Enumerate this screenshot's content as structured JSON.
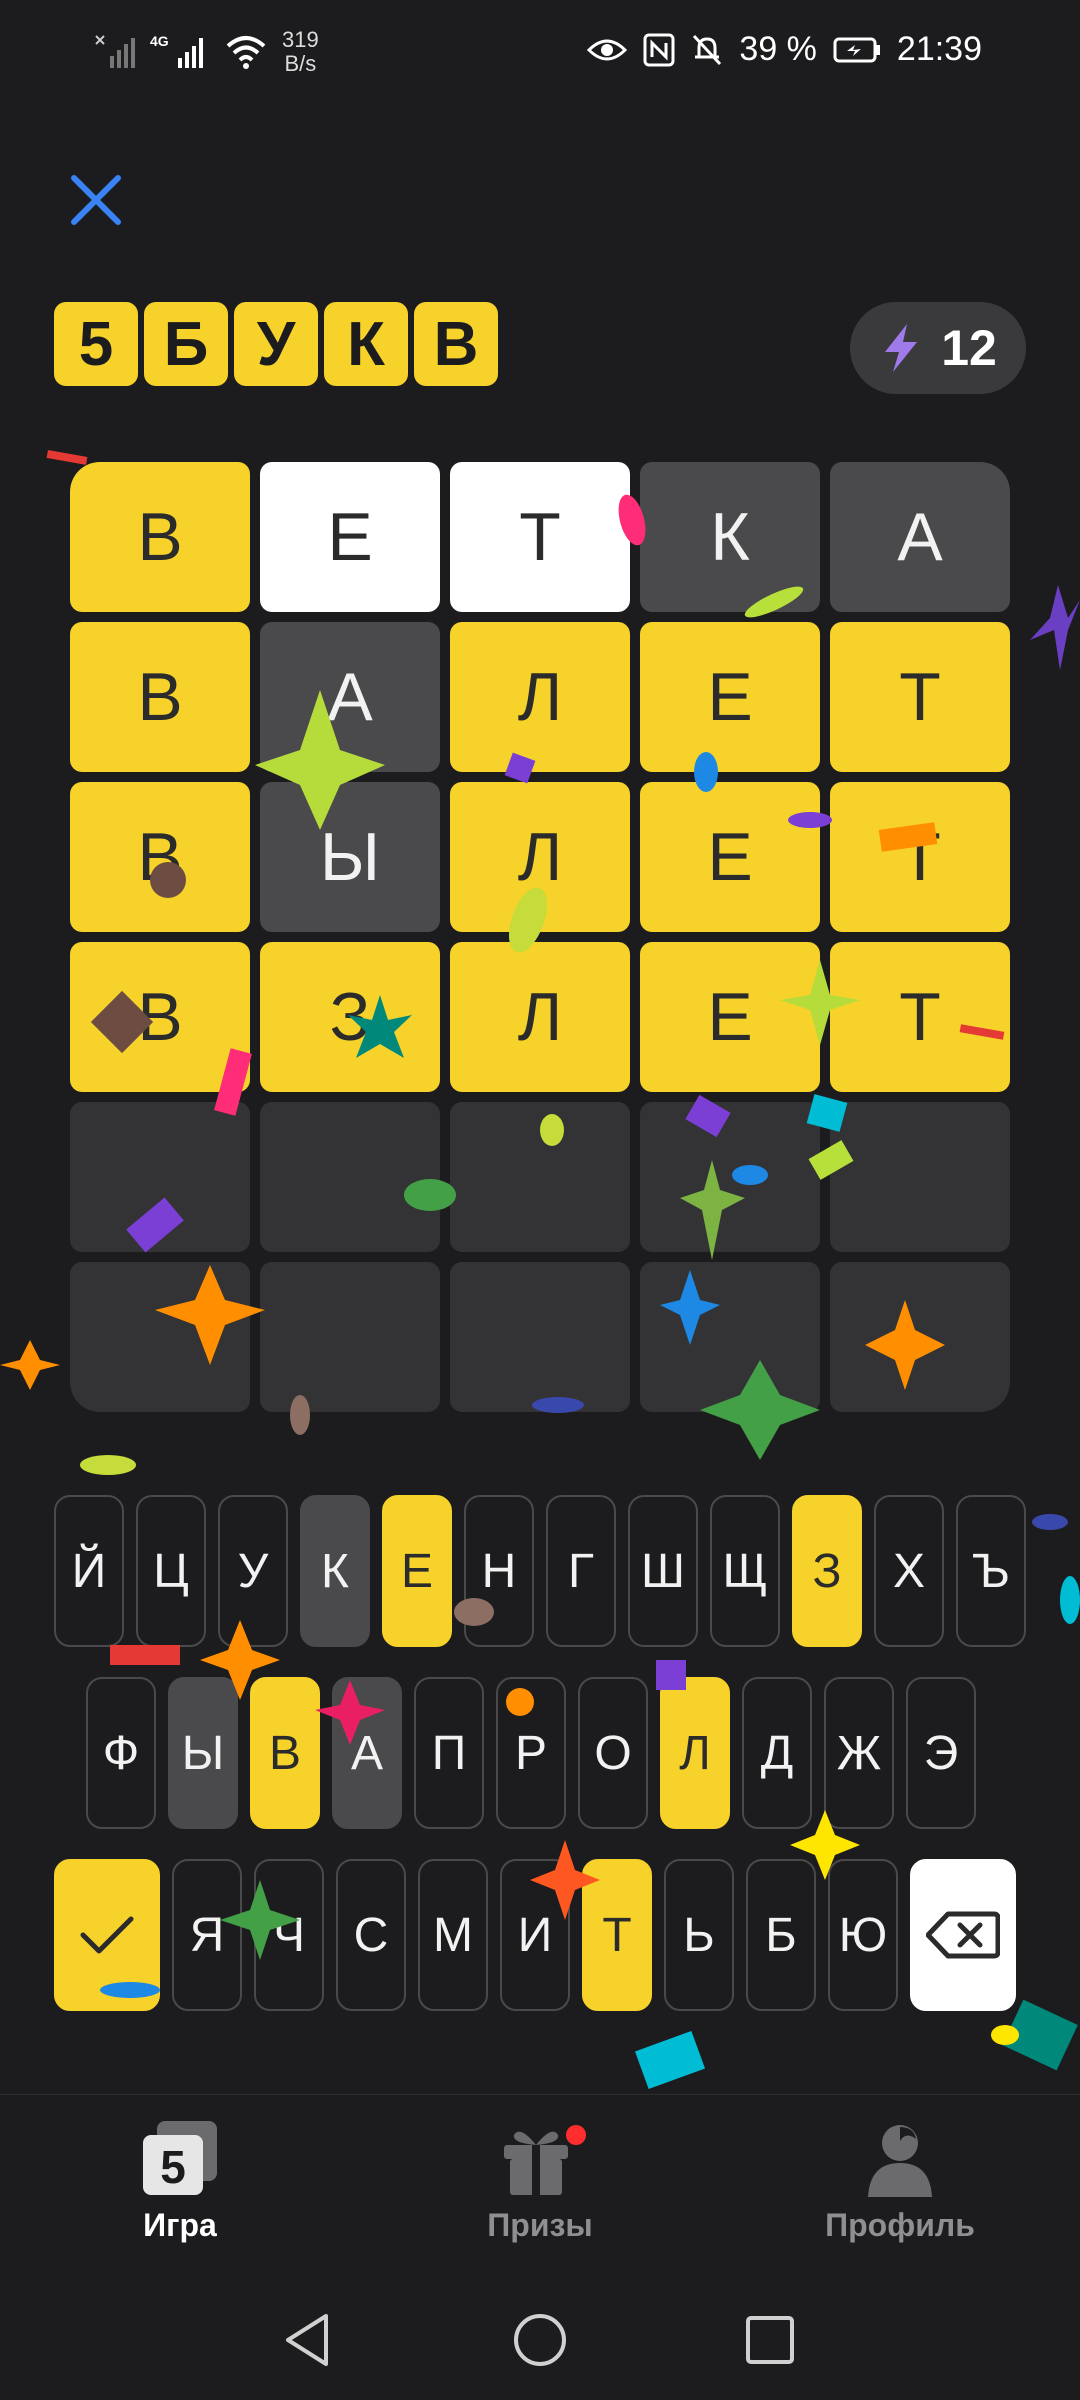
{
  "status_bar": {
    "net_speed_value": "319",
    "net_speed_unit": "B/s",
    "battery": "39 %",
    "time": "21:39"
  },
  "title_letters": [
    "5",
    "Б",
    "У",
    "К",
    "В"
  ],
  "energy": {
    "value": "12"
  },
  "board": [
    [
      {
        "l": "В",
        "s": "yellow"
      },
      {
        "l": "Е",
        "s": "white"
      },
      {
        "l": "Т",
        "s": "white"
      },
      {
        "l": "К",
        "s": "gray"
      },
      {
        "l": "А",
        "s": "gray"
      }
    ],
    [
      {
        "l": "В",
        "s": "yellow"
      },
      {
        "l": "А",
        "s": "gray"
      },
      {
        "l": "Л",
        "s": "yellow"
      },
      {
        "l": "Е",
        "s": "yellow"
      },
      {
        "l": "Т",
        "s": "yellow"
      }
    ],
    [
      {
        "l": "В",
        "s": "yellow"
      },
      {
        "l": "Ы",
        "s": "gray"
      },
      {
        "l": "Л",
        "s": "yellow"
      },
      {
        "l": "Е",
        "s": "yellow"
      },
      {
        "l": "Т",
        "s": "yellow"
      }
    ],
    [
      {
        "l": "В",
        "s": "yellow"
      },
      {
        "l": "З",
        "s": "yellow"
      },
      {
        "l": "Л",
        "s": "yellow"
      },
      {
        "l": "Е",
        "s": "yellow"
      },
      {
        "l": "Т",
        "s": "yellow"
      }
    ],
    [
      {
        "l": "",
        "s": "empty"
      },
      {
        "l": "",
        "s": "empty"
      },
      {
        "l": "",
        "s": "empty"
      },
      {
        "l": "",
        "s": "empty"
      },
      {
        "l": "",
        "s": "empty"
      }
    ],
    [
      {
        "l": "",
        "s": "empty"
      },
      {
        "l": "",
        "s": "empty"
      },
      {
        "l": "",
        "s": "empty"
      },
      {
        "l": "",
        "s": "empty"
      },
      {
        "l": "",
        "s": "empty"
      }
    ]
  ],
  "keyboard": {
    "row1": [
      {
        "k": "Й",
        "s": ""
      },
      {
        "k": "Ц",
        "s": ""
      },
      {
        "k": "У",
        "s": ""
      },
      {
        "k": "К",
        "s": "gray"
      },
      {
        "k": "Е",
        "s": "yellow"
      },
      {
        "k": "Н",
        "s": ""
      },
      {
        "k": "Г",
        "s": ""
      },
      {
        "k": "Ш",
        "s": ""
      },
      {
        "k": "Щ",
        "s": ""
      },
      {
        "k": "З",
        "s": "yellow"
      },
      {
        "k": "Х",
        "s": ""
      },
      {
        "k": "Ъ",
        "s": ""
      }
    ],
    "row2": [
      {
        "k": "Ф",
        "s": ""
      },
      {
        "k": "Ы",
        "s": "gray"
      },
      {
        "k": "В",
        "s": "yellow"
      },
      {
        "k": "А",
        "s": "gray"
      },
      {
        "k": "П",
        "s": ""
      },
      {
        "k": "Р",
        "s": ""
      },
      {
        "k": "О",
        "s": ""
      },
      {
        "k": "Л",
        "s": "yellow"
      },
      {
        "k": "Д",
        "s": ""
      },
      {
        "k": "Ж",
        "s": ""
      },
      {
        "k": "Э",
        "s": ""
      }
    ],
    "row3": [
      {
        "k": "Я",
        "s": ""
      },
      {
        "k": "Ч",
        "s": ""
      },
      {
        "k": "С",
        "s": ""
      },
      {
        "k": "М",
        "s": ""
      },
      {
        "k": "И",
        "s": ""
      },
      {
        "k": "Т",
        "s": "yellow"
      },
      {
        "k": "Ь",
        "s": ""
      },
      {
        "k": "Б",
        "s": ""
      },
      {
        "k": "Ю",
        "s": ""
      }
    ],
    "enter_icon": "check-icon",
    "backspace_icon": "backspace-icon"
  },
  "nav": {
    "game": {
      "label": "Игра",
      "icon": "game-logo-icon",
      "badge": "5"
    },
    "prizes": {
      "label": "Призы",
      "icon": "gift-icon"
    },
    "profile": {
      "label": "Профиль",
      "icon": "person-icon"
    }
  },
  "colors": {
    "background": "#1c1c1e",
    "correct": "#f6d22b",
    "absent": "#4a4a4c",
    "empty": "#333335",
    "accent_close": "#3b82f6",
    "notify_dot": "#ff2d2d"
  }
}
